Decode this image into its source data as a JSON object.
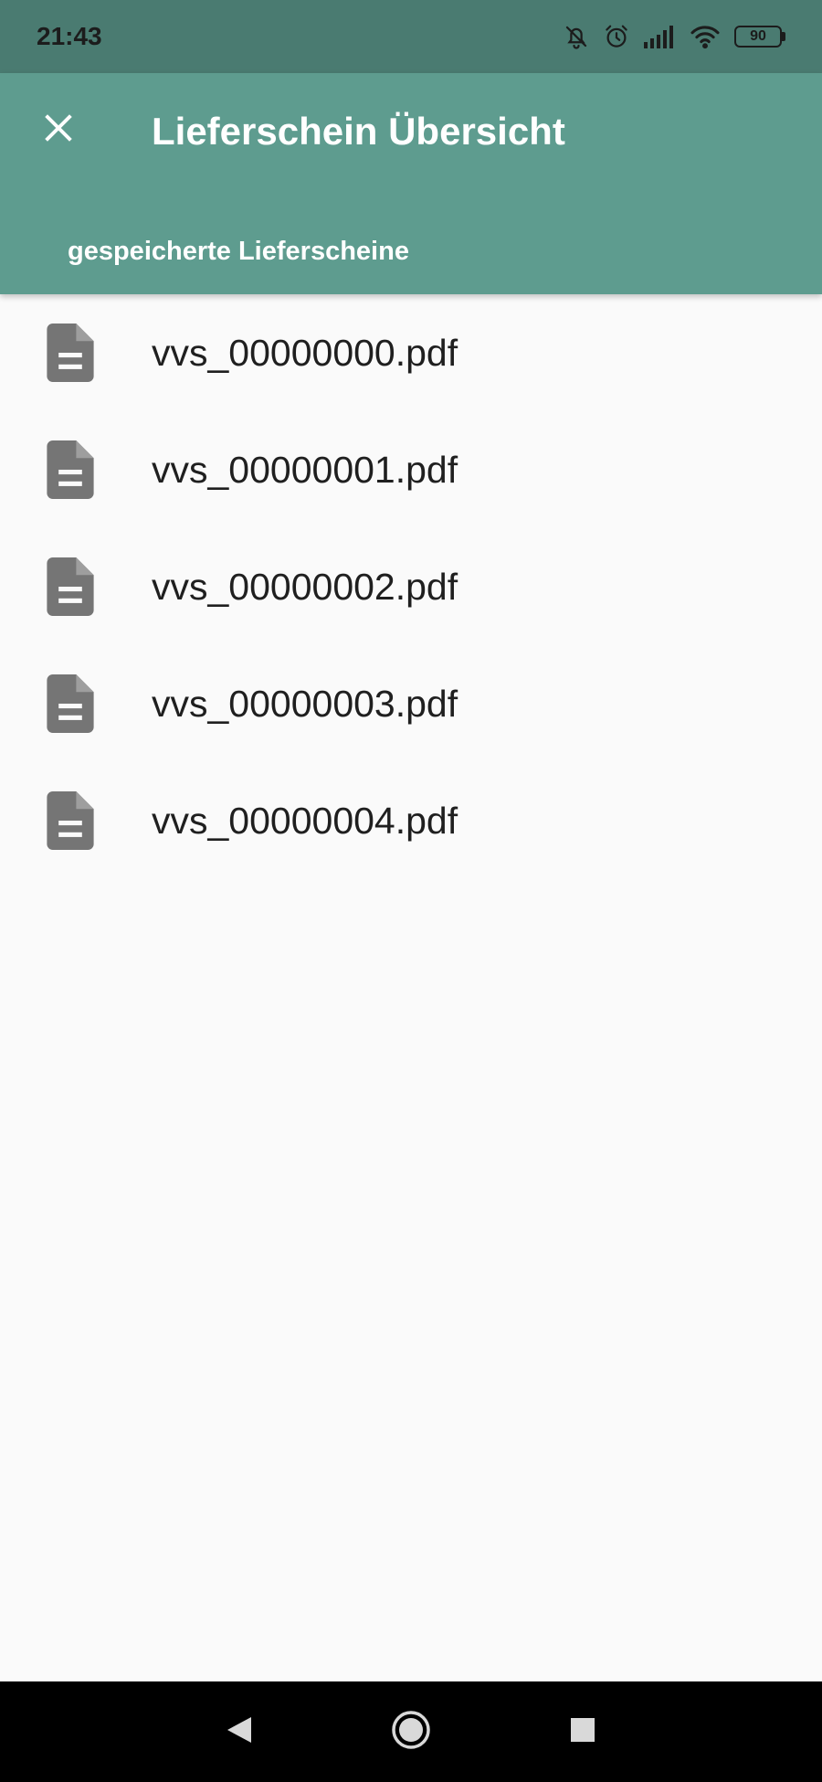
{
  "status_bar": {
    "time": "21:43",
    "battery": "90",
    "icons": [
      "notifications-off-icon",
      "alarm-icon",
      "signal-icon",
      "wifi-icon",
      "battery-icon"
    ]
  },
  "app_bar": {
    "title": "Lieferschein Übersicht",
    "close_icon": "close-icon",
    "tab_label": "gespeicherte Lieferscheine",
    "color": "#5e9c8f"
  },
  "files": [
    {
      "name": "vvs_00000000.pdf",
      "icon": "document-icon"
    },
    {
      "name": "vvs_00000001.pdf",
      "icon": "document-icon"
    },
    {
      "name": "vvs_00000002.pdf",
      "icon": "document-icon"
    },
    {
      "name": "vvs_00000003.pdf",
      "icon": "document-icon"
    },
    {
      "name": "vvs_00000004.pdf",
      "icon": "document-icon"
    }
  ],
  "nav_bar": {
    "buttons": [
      "back-icon",
      "home-icon",
      "recents-icon"
    ]
  },
  "colors": {
    "status_bar": "#4a7b71",
    "background": "#fafafa",
    "icon": "#757575"
  }
}
